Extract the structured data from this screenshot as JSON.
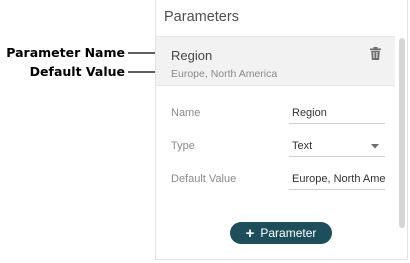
{
  "callouts": {
    "name_label": "Parameter  Name",
    "default_label": "Default Value"
  },
  "panel": {
    "title": "Parameters",
    "item": {
      "name": "Region",
      "default_value": "Europe, North America",
      "delete_icon": "trash-icon"
    },
    "form": {
      "name_label": "Name",
      "name_value": "Region",
      "type_label": "Type",
      "type_value": "Text",
      "default_label": "Default Value",
      "default_value": "Europe, North America"
    },
    "add_button": {
      "icon": "plus-icon",
      "label": "Parameter"
    }
  },
  "colors": {
    "button": "#1d4e5c",
    "item_background": "#f2f2f2"
  }
}
